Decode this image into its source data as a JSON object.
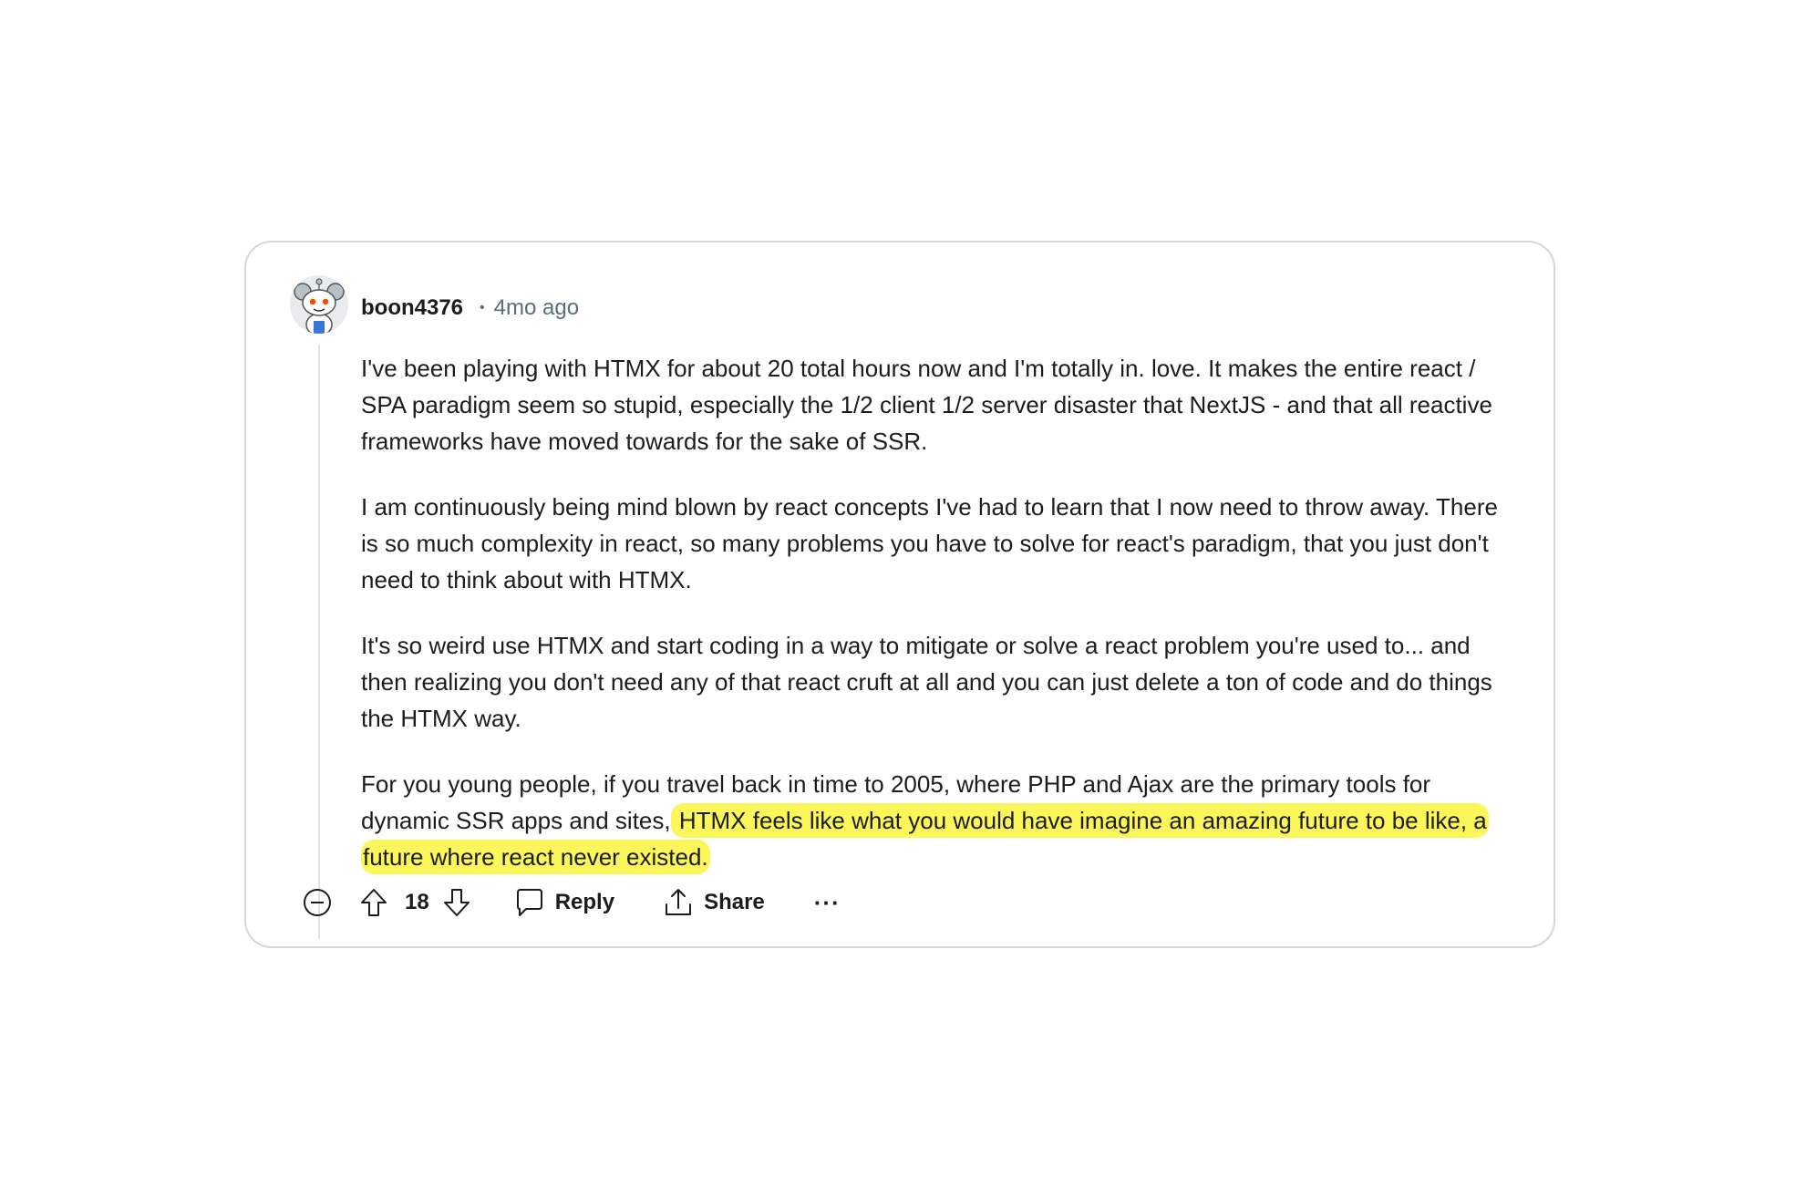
{
  "comment": {
    "author": "boon4376",
    "separator": "•",
    "time": "4mo ago",
    "avatar_icon": "reddit-snoo-avatar-icon",
    "paragraphs": [
      {
        "text": "I've been playing with HTMX for about 20 total hours now and I'm totally in. love. It makes the entire react / SPA paradigm seem so stupid, especially the 1/2 client 1/2 server disaster that NextJS - and that all reactive frameworks have moved towards for the sake of SSR."
      },
      {
        "text": "I am continuously being mind blown by react concepts I've had to learn that I now need to throw away. There is so much complexity in react, so many problems you have to solve for react's paradigm, that you just don't need to think about with HTMX."
      },
      {
        "text": "It's so weird use HTMX and start coding in a way to mitigate or solve a react problem you're used to... and then realizing you don't need any of that react cruft at all and you can just delete a ton of code and do things the HTMX way."
      },
      {
        "text": "For you young people, if you travel back in time to 2005, where PHP and Ajax are the primary tools for dynamic SSR apps and sites,",
        "highlight": " HTMX feels like what you would have imagine an amazing future to be like, a future where react never existed."
      }
    ],
    "highlight_color": "#fbf65a"
  },
  "actions": {
    "collapse_icon": "collapse-minus-icon",
    "upvote_icon": "upvote-arrow-icon",
    "vote_count": "18",
    "downvote_icon": "downvote-arrow-icon",
    "reply_icon": "comment-bubble-icon",
    "reply_label": "Reply",
    "share_icon": "share-icon",
    "share_label": "Share",
    "more_label": "···"
  }
}
